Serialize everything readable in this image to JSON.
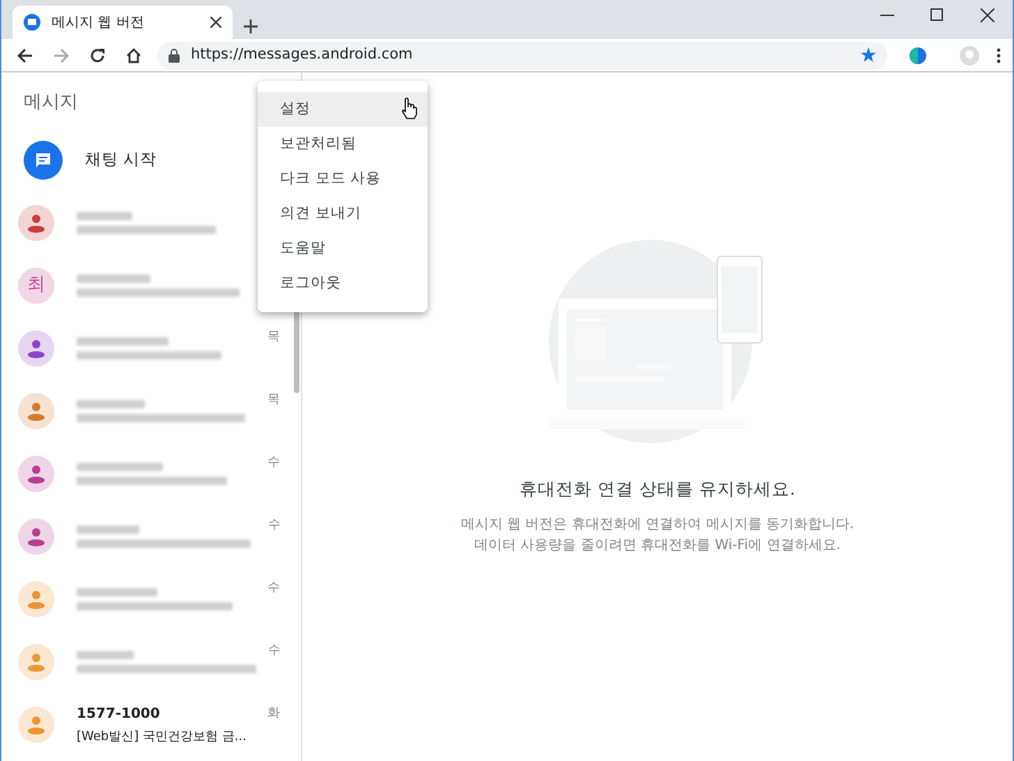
{
  "browser": {
    "tab_title": "메시지 웹 버전",
    "url": "https://messages.android.com"
  },
  "sidebar": {
    "title": "메시지",
    "start_chat": "채팅 시작",
    "conversations": [
      {
        "kind": "hidden",
        "color": "#c5403a"
      },
      {
        "kind": "hidden",
        "initial": "최",
        "color": "#c2478e"
      },
      {
        "kind": "hidden",
        "color": "#8e44c4",
        "date": "목"
      },
      {
        "kind": "hidden",
        "color": "#d47a2a",
        "date": "목"
      },
      {
        "kind": "hidden",
        "color": "#b73f8e",
        "date": "수"
      },
      {
        "kind": "hidden",
        "color": "#b73f8e",
        "date": "수"
      },
      {
        "kind": "hidden",
        "color": "#eb9535",
        "date": "수"
      },
      {
        "kind": "hidden",
        "color": "#eb9535",
        "date": "수"
      },
      {
        "kind": "shown",
        "color": "#eb9535",
        "date": "화",
        "name": "1577-1000",
        "preview": "[Web발신] 국민건강보험 금..."
      }
    ]
  },
  "menu": [
    {
      "label": "설정",
      "selected": true
    },
    {
      "label": "보관처리됨",
      "selected": false
    },
    {
      "label": "다크 모드 사용",
      "selected": false
    },
    {
      "label": "의견 보내기",
      "selected": false
    },
    {
      "label": "도움말",
      "selected": false
    },
    {
      "label": "로그아웃",
      "selected": false
    }
  ],
  "empty_state": {
    "heading": "휴대전화 연결 상태를 유지하세요.",
    "lines": [
      "메시지 웹 버전은 휴대전화에 연결하여 메시지를 동기화합니다.",
      "데이터 사용량을 줄이려면 휴대전화를 Wi-Fi에 연결하세요."
    ]
  }
}
